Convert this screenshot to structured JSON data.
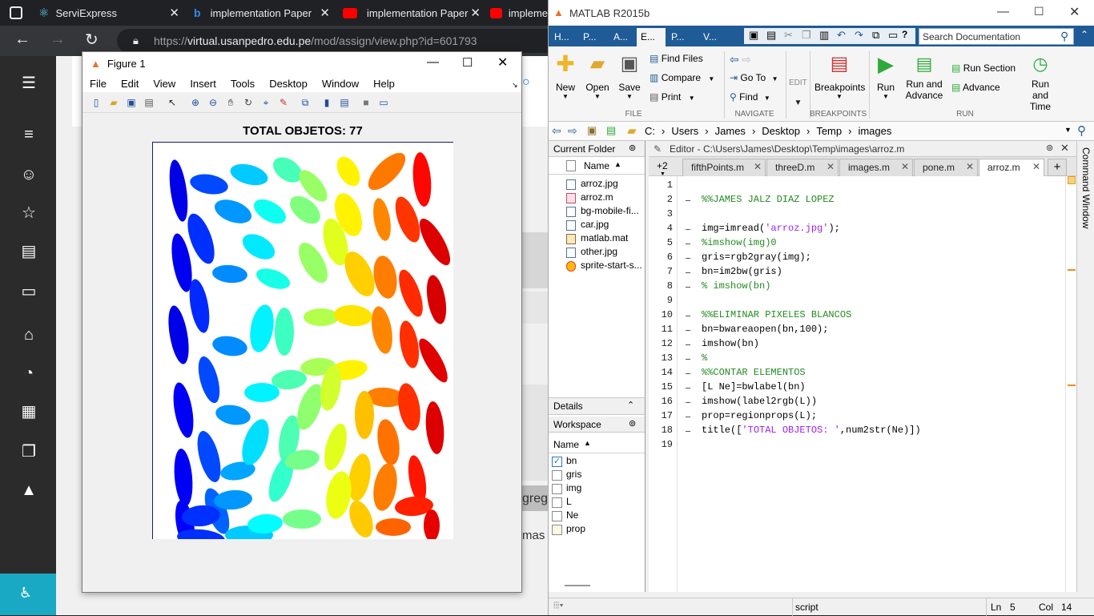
{
  "browser": {
    "tabs": [
      {
        "label": "ServiExpress",
        "icon": "react-icon"
      },
      {
        "label": "implementation Paper",
        "icon": "bing-icon"
      },
      {
        "label": "implementation Paper",
        "icon": "youtube-icon"
      },
      {
        "label": "impleme",
        "icon": "youtube-icon"
      }
    ],
    "url_prefix": "https://",
    "url_host": "virtual.usanpedro.edu.pe",
    "url_path": "/mod/assign/view.php?id=601793",
    "page_text_1": "gregar",
    "page_text_2": "mas r"
  },
  "figure": {
    "window_title": "Figure 1",
    "menu": [
      "File",
      "Edit",
      "View",
      "Insert",
      "Tools",
      "Desktop",
      "Window",
      "Help"
    ],
    "plot_title": "TOTAL OBJETOS: 77"
  },
  "matlab": {
    "window_title": "MATLAB R2015b",
    "toolstrip_tabs": [
      "H...",
      "P...",
      "A...",
      "E...",
      "P...",
      "V..."
    ],
    "search_placeholder": "Search Documentation",
    "ribbon": {
      "new": "New",
      "open": "Open",
      "save": "Save",
      "find_files": "Find Files",
      "compare": "Compare",
      "print": "Print",
      "go_to": "Go To",
      "find": "Find",
      "edit": "EDIT",
      "breakpoints": "Breakpoints",
      "run": "Run",
      "run_and_advance": "Run and Advance",
      "run_section": "Run Section",
      "advance": "Advance",
      "run_and_time": "Run and Time",
      "sec_file": "FILE",
      "sec_navigate": "NAVIGATE",
      "sec_breakpoints": "BREAKPOINTS",
      "sec_run": "RUN"
    },
    "address": [
      "C:",
      "Users",
      "James",
      "Desktop",
      "Temp",
      "images"
    ],
    "current_folder": {
      "title": "Current Folder",
      "column": "Name",
      "files": [
        "arroz.jpg",
        "arroz.m",
        "bg-mobile-fi...",
        "car.jpg",
        "matlab.mat",
        "other.jpg",
        "sprite-start-s..."
      ]
    },
    "details_label": "Details",
    "workspace": {
      "title": "Workspace",
      "column": "Name",
      "vars": [
        "bn",
        "gris",
        "img",
        "L",
        "Ne",
        "prop"
      ]
    },
    "editor": {
      "title": "Editor - C:\\Users\\James\\Desktop\\Temp\\images\\arroz.m",
      "tab_overflow": "+2",
      "tabs": [
        "fifthPoints.m",
        "threeD.m",
        "images.m",
        "pone.m",
        "arroz.m"
      ],
      "side_label": "Command Window"
    },
    "code": [
      {
        "n": "1",
        "parts": [
          {
            "t": "",
            "c": ""
          }
        ]
      },
      {
        "n": "2",
        "parts": [
          {
            "t": "%%JAMES JALZ DIAZ LOPEZ",
            "c": "cm"
          }
        ]
      },
      {
        "n": "3",
        "parts": [
          {
            "t": "",
            "c": ""
          }
        ]
      },
      {
        "n": "4",
        "parts": [
          {
            "t": "img=imread(",
            "c": ""
          },
          {
            "t": "'arroz.jpg'",
            "c": "str"
          },
          {
            "t": ");",
            "c": ""
          }
        ]
      },
      {
        "n": "5",
        "parts": [
          {
            "t": "%imshow(img)0",
            "c": "cm"
          }
        ]
      },
      {
        "n": "6",
        "parts": [
          {
            "t": "gris=rgb2gray(img);",
            "c": ""
          }
        ]
      },
      {
        "n": "7",
        "parts": [
          {
            "t": "bn=im2bw(gris)",
            "c": ""
          }
        ]
      },
      {
        "n": "8",
        "parts": [
          {
            "t": "% imshow(bn)",
            "c": "cm"
          }
        ]
      },
      {
        "n": "9",
        "parts": [
          {
            "t": "",
            "c": ""
          }
        ]
      },
      {
        "n": "10",
        "parts": [
          {
            "t": "%%ELIMINAR PIXELES BLANCOS",
            "c": "cm"
          }
        ]
      },
      {
        "n": "11",
        "parts": [
          {
            "t": "bn=bwareaopen(bn,100);",
            "c": ""
          }
        ]
      },
      {
        "n": "12",
        "parts": [
          {
            "t": "imshow(bn)",
            "c": ""
          }
        ]
      },
      {
        "n": "13",
        "parts": [
          {
            "t": "%",
            "c": "cm"
          }
        ]
      },
      {
        "n": "14",
        "parts": [
          {
            "t": "%%CONTAR ELEMENTOS",
            "c": "cm"
          }
        ]
      },
      {
        "n": "15",
        "parts": [
          {
            "t": "[L Ne]=bwlabel(bn)",
            "c": ""
          }
        ]
      },
      {
        "n": "16",
        "parts": [
          {
            "t": "imshow(label2rgb(L))",
            "c": ""
          }
        ]
      },
      {
        "n": "17",
        "parts": [
          {
            "t": "prop=regionprops(L);",
            "c": ""
          }
        ]
      },
      {
        "n": "18",
        "parts": [
          {
            "t": "title([",
            "c": ""
          },
          {
            "t": "'TOTAL OBJETOS: '",
            "c": "str"
          },
          {
            "t": ",num2str(Ne)])",
            "c": ""
          }
        ]
      },
      {
        "n": "19",
        "parts": [
          {
            "t": "",
            "c": ""
          }
        ]
      }
    ],
    "status": {
      "mode": "script",
      "ln_label": "Ln",
      "ln": "5",
      "col_label": "Col",
      "col": "14"
    }
  }
}
